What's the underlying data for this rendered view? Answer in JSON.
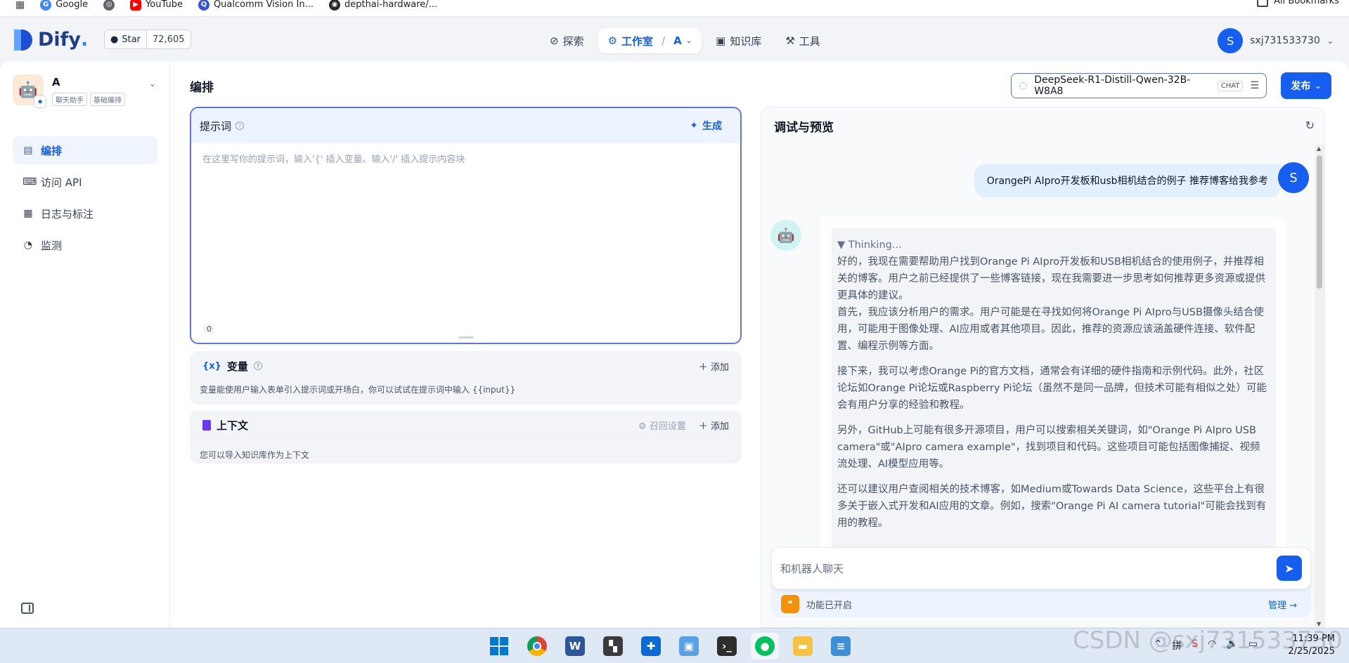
{
  "bookmarks": {
    "items": [
      "Google",
      "",
      "YouTube",
      "Qualcomm Vision In...",
      "depthai-hardware/..."
    ],
    "all_bookmarks": "All Bookmarks"
  },
  "header": {
    "logo_text": "Dify",
    "logo_dot": ".",
    "star_label": "Star",
    "star_count": "72,605",
    "nav": [
      {
        "label": "探索"
      },
      {
        "label": "工作室",
        "sub": "A"
      },
      {
        "label": "知识库"
      },
      {
        "label": "工具"
      }
    ],
    "user_initial": "S",
    "user_name": "sxj731533730"
  },
  "sidebar": {
    "app_name": "A",
    "tags": [
      "聊天助手",
      "基础编排"
    ],
    "items": [
      {
        "label": "编排"
      },
      {
        "label": "访问 API"
      },
      {
        "label": "日志与标注"
      },
      {
        "label": "监测"
      }
    ]
  },
  "orchestrate": {
    "title": "编排",
    "prompt": {
      "title": "提示词",
      "generate": "生成",
      "placeholder": "在这里写你的提示词，输入'{' 插入变量、输入'/' 插入提示内容块",
      "count": "0"
    },
    "variables": {
      "icon": "{x}",
      "title": "变量",
      "add": "添加",
      "desc": "变量能使用户输入表单引入提示词或开场白，你可以试试在提示词中输入 {{input}}"
    },
    "context": {
      "title": "上下文",
      "recall": "召回设置",
      "add": "添加",
      "desc": "您可以导入知识库作为上下文"
    }
  },
  "model": {
    "name": "DeepSeek-R1-Distill-Qwen-32B-W8A8",
    "badge": "CHAT"
  },
  "publish_label": "发布",
  "preview": {
    "title": "调试与预览",
    "user_initial": "S",
    "user_message": "OrangePi AIpro开发板和usb相机结合的例子 推荐博客给我参考",
    "thinking_label": "▼ Thinking...",
    "paragraphs": [
      "好的，我现在需要帮助用户找到Orange Pi AIpro开发板和USB相机结合的使用例子，并推荐相关的博客。用户之前已经提供了一些博客链接，现在我需要进一步思考如何推荐更多资源或提供更具体的建议。\n首先，我应该分析用户的需求。用户可能是在寻找如何将Orange Pi AIpro与USB摄像头结合使用，可能用于图像处理、AI应用或者其他项目。因此，推荐的资源应该涵盖硬件连接、软件配置、编程示例等方面。",
      "接下来，我可以考虑Orange Pi的官方文档，通常会有详细的硬件指南和示例代码。此外，社区论坛如Orange Pi论坛或Raspberry Pi论坛（虽然不是同一品牌，但技术可能有相似之处）可能会有用户分享的经验和教程。",
      "另外，GitHub上可能有很多开源项目，用户可以搜索相关关键词，如\"Orange Pi AIpro USB camera\"或\"AIpro camera example\"，找到项目和代码。这些项目可能包括图像捕捉、视频流处理、AI模型应用等。",
      "还可以建议用户查阅相关的技术博客，如Medium或Towards Data Science，这些平台上有很多关于嵌入式开发和AI应用的文章。例如，搜索\"Orange Pi AI camera tutorial\"可能会找到有用的教程。"
    ],
    "input_placeholder": "和机器人聊天",
    "feature_text": "功能已开启",
    "manage": "管理 →"
  },
  "taskbar": {
    "time": "11:39 PM",
    "date": "2/25/2025",
    "watermark": "CSDN @sxj731533730"
  }
}
